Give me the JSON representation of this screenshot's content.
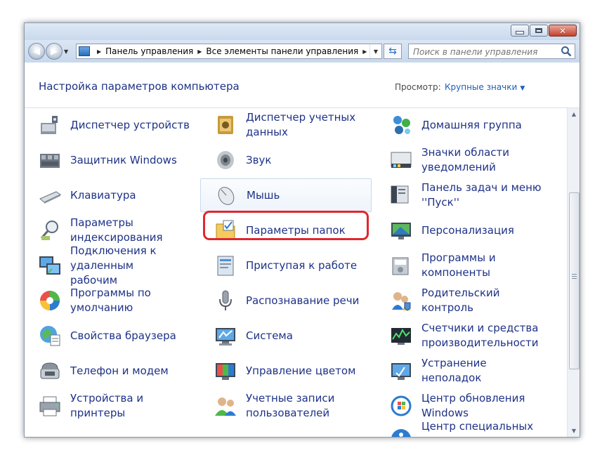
{
  "window": {
    "caption_buttons": [
      "minimize",
      "maximize",
      "close"
    ]
  },
  "navbar": {
    "breadcrumbs": [
      "Панель управления",
      "Все элементы панели управления"
    ],
    "search_placeholder": "Поиск в панели управления"
  },
  "header": {
    "title": "Настройка параметров компьютера",
    "view_label": "Просмотр:",
    "view_value": "Крупные значки"
  },
  "items": [
    {
      "id": "device-manager",
      "label": "Диспетчер устройств",
      "icon": "device-manager-icon"
    },
    {
      "id": "credential-manager",
      "label": "Диспетчер учетных данных",
      "icon": "credential-manager-icon"
    },
    {
      "id": "homegroup",
      "label": "Домашняя группа",
      "icon": "homegroup-icon"
    },
    {
      "id": "windows-defender",
      "label": "Защитник Windows",
      "icon": "defender-icon"
    },
    {
      "id": "sound",
      "label": "Звук",
      "icon": "speaker-icon"
    },
    {
      "id": "notification-icons",
      "label": "Значки области уведомлений",
      "icon": "notification-area-icon"
    },
    {
      "id": "keyboard",
      "label": "Клавиатура",
      "icon": "keyboard-icon"
    },
    {
      "id": "mouse",
      "label": "Мышь",
      "icon": "mouse-icon"
    },
    {
      "id": "taskbar",
      "label": "Панель задач и меню ''Пуск''",
      "icon": "taskbar-icon"
    },
    {
      "id": "indexing",
      "label": "Параметры индексирования",
      "icon": "indexing-icon"
    },
    {
      "id": "folder-options",
      "label": "Параметры папок",
      "icon": "folder-options-icon"
    },
    {
      "id": "personalization",
      "label": "Персонализация",
      "icon": "personalization-icon"
    },
    {
      "id": "remote-desktop",
      "label": "Подключения к удаленным рабочим",
      "icon": "remote-desktop-icon"
    },
    {
      "id": "getting-started",
      "label": "Приступая к работе",
      "icon": "getting-started-icon"
    },
    {
      "id": "programs-features",
      "label": "Программы и компоненты",
      "icon": "programs-features-icon"
    },
    {
      "id": "default-programs",
      "label": "Программы по умолчанию",
      "icon": "default-programs-icon"
    },
    {
      "id": "speech",
      "label": "Распознавание речи",
      "icon": "microphone-icon"
    },
    {
      "id": "parental-controls",
      "label": "Родительский контроль",
      "icon": "parental-controls-icon"
    },
    {
      "id": "internet-options",
      "label": "Свойства браузера",
      "icon": "internet-options-icon"
    },
    {
      "id": "system",
      "label": "Система",
      "icon": "system-icon"
    },
    {
      "id": "performance",
      "label": "Счетчики и средства производительности",
      "icon": "performance-icon"
    },
    {
      "id": "phone-modem",
      "label": "Телефон и модем",
      "icon": "phone-modem-icon"
    },
    {
      "id": "color-management",
      "label": "Управление цветом",
      "icon": "color-management-icon"
    },
    {
      "id": "troubleshooting",
      "label": "Устранение неполадок",
      "icon": "troubleshooting-icon"
    },
    {
      "id": "devices-printers",
      "label": "Устройства и принтеры",
      "icon": "printer-icon"
    },
    {
      "id": "user-accounts",
      "label": "Учетные записи пользователей",
      "icon": "user-accounts-icon"
    },
    {
      "id": "windows-update",
      "label": "Центр обновления Windows",
      "icon": "windows-update-icon"
    },
    {
      "id": "partial-1",
      "label": "",
      "icon": "partial-icon"
    },
    {
      "id": "partial-2",
      "label": "",
      "icon": "partial-icon"
    },
    {
      "id": "ease-of-access",
      "label": "Центр специальных",
      "icon": "ease-of-access-icon"
    }
  ],
  "colors": {
    "link_text": "#1e3287",
    "highlight": "#e1262e"
  }
}
